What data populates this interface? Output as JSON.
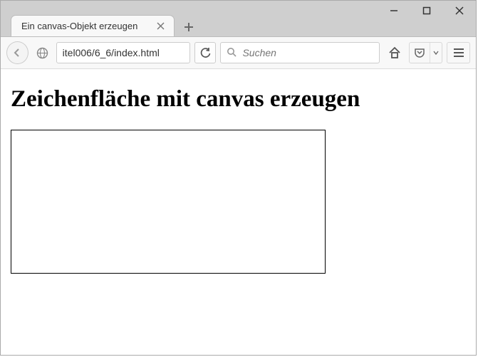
{
  "window": {
    "tab_title": "Ein canvas-Objekt erzeugen"
  },
  "toolbar": {
    "url": "itel006/6_6/index.html",
    "search_placeholder": "Suchen"
  },
  "page": {
    "heading": "Zeichenfläche mit canvas erzeugen"
  }
}
